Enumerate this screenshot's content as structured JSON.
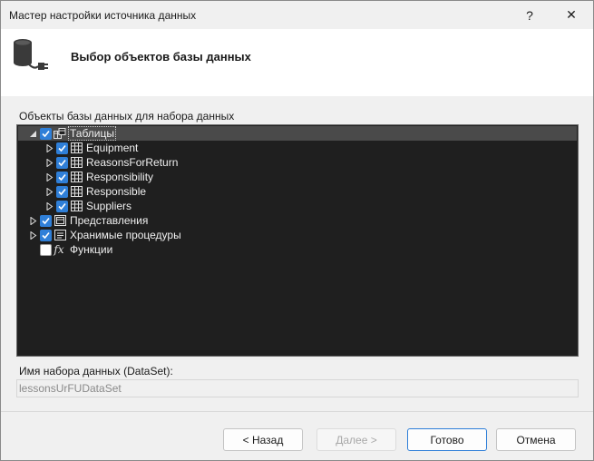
{
  "window": {
    "title": "Мастер настройки источника данных",
    "help_glyph": "?",
    "close_glyph": "✕"
  },
  "header": {
    "title": "Выбор объектов базы данных"
  },
  "objects_section": {
    "label": "Объекты базы данных для набора данных"
  },
  "tree": {
    "tables": {
      "label": "Таблицы",
      "checked": true,
      "expanded": true,
      "children": [
        {
          "label": "Equipment",
          "checked": true
        },
        {
          "label": "ReasonsForReturn",
          "checked": true
        },
        {
          "label": "Responsibility",
          "checked": true
        },
        {
          "label": "Responsible",
          "checked": true
        },
        {
          "label": "Suppliers",
          "checked": true
        }
      ]
    },
    "views": {
      "label": "Представления",
      "checked": true
    },
    "procedures": {
      "label": "Хранимые процедуры",
      "checked": true
    },
    "functions": {
      "label": "Функции",
      "checked": false,
      "icon_text": "fx"
    }
  },
  "dataset": {
    "label": "Имя набора данных (DataSet):",
    "value": "lessonsUrFUDataSet"
  },
  "buttons": {
    "back": "< Назад",
    "next": "Далее >",
    "finish": "Готово",
    "cancel": "Отмена"
  },
  "colors": {
    "accent": "#2f7fd8",
    "tree_bg": "#1f1f1f",
    "selected_row": "#4a4a4a"
  }
}
